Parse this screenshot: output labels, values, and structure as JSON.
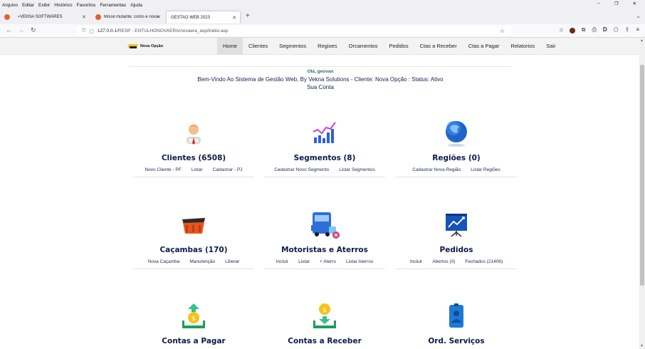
{
  "menu": [
    "Arquivo",
    "Editar",
    "Exibir",
    "Histórico",
    "Favoritos",
    "Ferramentas",
    "Ajuda"
  ],
  "tabs": [
    {
      "label": "VEKNA SOFTWARES"
    },
    {
      "label": "Míssil mutante: como é nova ar..."
    },
    {
      "label": "GESTAO WEB 2023"
    }
  ],
  "url": {
    "host": "127.0.0.1",
    "path": "/RESP - ENTULHONOVAERA/novaera_asp/index.asp"
  },
  "logo_text": "Nova Opção",
  "nav": [
    "Home",
    "Clientes",
    "Segmentos",
    "Regioes",
    "Orcamentos",
    "Pedidos",
    "Ctas a Receber",
    "Ctas a Pagar",
    "Relatorios",
    "Sair"
  ],
  "welcome": {
    "hi": "Olá, geovan",
    "line": "Bem-Vindo Ao Sistema de Gestão Web, By Vekna Solutions - Cliente: Nova Opção : Status: Ativo",
    "account": "Sua Conta"
  },
  "cards": [
    {
      "title": "Clientes (6508)",
      "icon": "user-icon",
      "links": [
        "Novo Cliente - PF",
        "Listar",
        "Cadastrar - PJ"
      ]
    },
    {
      "title": "Segmentos (8)",
      "icon": "bar-chart-icon",
      "links": [
        "Cadastrar Novo Segmento",
        "Listar Segmentos"
      ]
    },
    {
      "title": "Regiões (0)",
      "icon": "globe-icon",
      "links": [
        "Cadastrar Nova Região",
        "Listar Regiões"
      ]
    },
    {
      "title": "Caçambas (170)",
      "icon": "dumpster-icon",
      "links": [
        "Nova Caçamba",
        "Manutenção",
        "Liberar"
      ]
    },
    {
      "title": "Motoristas e Aterros",
      "icon": "truck-icon",
      "links": [
        "Incluir",
        "Listar",
        "+ Aterro",
        "Listar Aterros"
      ]
    },
    {
      "title": "Pedidos",
      "icon": "presentation-icon",
      "links": [
        "Incluir",
        "Abertos (0)",
        "Fechados (21406)"
      ]
    },
    {
      "title": "Contas a Pagar",
      "icon": "money-up-icon",
      "links": []
    },
    {
      "title": "Contas a Receber",
      "icon": "money-down-icon",
      "links": []
    },
    {
      "title": "Ord. Serviços",
      "icon": "badge-icon",
      "links": []
    }
  ]
}
